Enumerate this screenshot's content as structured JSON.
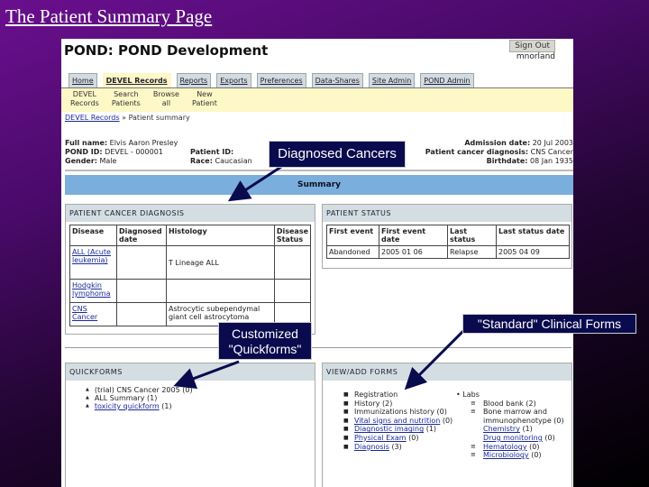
{
  "slide_title": "The Patient Summary Page",
  "app": {
    "title": "POND: POND Development",
    "signout_label": "Sign Out",
    "username": "mnorland"
  },
  "tabs": [
    {
      "label": "Home",
      "active": false
    },
    {
      "label": "DEVEL Records",
      "active": true
    },
    {
      "label": "Reports",
      "active": false
    },
    {
      "label": "Exports",
      "active": false
    },
    {
      "label": "Preferences",
      "active": false
    },
    {
      "label": "Data-Shares",
      "active": false
    },
    {
      "label": "Site Admin",
      "active": false
    },
    {
      "label": "POND Admin",
      "active": false
    }
  ],
  "subnav": [
    {
      "line1": "DEVEL",
      "line2": "Records"
    },
    {
      "line1": "Search",
      "line2": "Patients"
    },
    {
      "line1": "Browse",
      "line2": "all"
    },
    {
      "line1": "New",
      "line2": "Patient"
    }
  ],
  "breadcrumb": {
    "link": "DEVEL Records",
    "sep": "»",
    "current": "Patient summary"
  },
  "patient": {
    "full_name_label": "Full name:",
    "full_name": "Elvis Aaron Presley",
    "pond_id_label": "POND ID:",
    "pond_id": "DEVEL - 000001",
    "gender_label": "Gender:",
    "gender": "Male",
    "patient_id_label": "Patient ID:",
    "patient_id": "",
    "race_label": "Race:",
    "race": "Caucasian",
    "admission_label": "Admission date:",
    "admission": "20 Jul 2003",
    "diagnosis_label": "Patient cancer diagnosis:",
    "diagnosis": "CNS Cancer",
    "birthdate_label": "Birthdate:",
    "birthdate": "08 Jan 1935"
  },
  "summary_label": "Summary",
  "cancer_diagnosis": {
    "title": "Patient Cancer Diagnosis",
    "headers": [
      "Disease",
      "Diagnosed date",
      "Histology",
      "Disease Status"
    ],
    "rows": [
      {
        "disease": "ALL (Acute leukemia)",
        "date": "",
        "histology": "T Lineage ALL",
        "status": ""
      },
      {
        "disease": "Hodgkin lymphoma",
        "date": "",
        "histology": "",
        "status": ""
      },
      {
        "disease": "CNS Cancer",
        "date": "",
        "histology": "Astrocytic subependymal giant cell astrocytoma",
        "status": ""
      }
    ]
  },
  "patient_status": {
    "title": "Patient Status",
    "headers": [
      "First event",
      "First event date",
      "Last status",
      "Last status date"
    ],
    "rows": [
      {
        "first_event": "Abandoned",
        "first_event_date": "2005 01 06",
        "last_status": "Relapse",
        "last_status_date": "2005 04 09"
      }
    ]
  },
  "quickforms": {
    "title": "Quickforms",
    "items": [
      {
        "label": "(trial) CNS Cancer 2005",
        "count": "(0)",
        "link": false
      },
      {
        "label": "ALL Summary",
        "count": "(1)",
        "link": false
      },
      {
        "label": "toxicity quickform",
        "count": "(1)",
        "link": true
      }
    ]
  },
  "view_add_forms": {
    "title": "View/Add Forms",
    "left": [
      {
        "label": "Registration",
        "count": "",
        "link": false
      },
      {
        "label": "History",
        "count": "(2)",
        "link": false
      },
      {
        "label": "Immunizations history",
        "count": "(0)",
        "link": false
      },
      {
        "label": "Vital signs and nutrition",
        "count": "(0)",
        "link": true
      },
      {
        "label": "Diagnostic imaging",
        "count": "(1)",
        "link": true
      },
      {
        "label": "Physical Exam",
        "count": "(0)",
        "link": true
      },
      {
        "label": "Diagnosis",
        "count": "(3)",
        "link": true
      }
    ],
    "labs_label": "Labs",
    "labs": [
      {
        "label": "Blood bank",
        "count": "(2)",
        "link": false
      },
      {
        "label": "Bone marrow and immunophenotype",
        "count": "(0)",
        "link": false
      },
      {
        "label": "Chemistry",
        "count": "(1)",
        "link": true
      },
      {
        "label": "Drug monitoring",
        "count": "(0)",
        "link": true
      },
      {
        "label": "Hematology",
        "count": "(0)",
        "link": true
      },
      {
        "label": "Microbiology",
        "count": "(0)",
        "link": true
      }
    ]
  },
  "callouts": {
    "diagnosed": "Diagnosed Cancers",
    "customized_1": "Customized",
    "customized_2": "\"Quickforms\"",
    "standard": "\"Standard\" Clinical Forms"
  }
}
